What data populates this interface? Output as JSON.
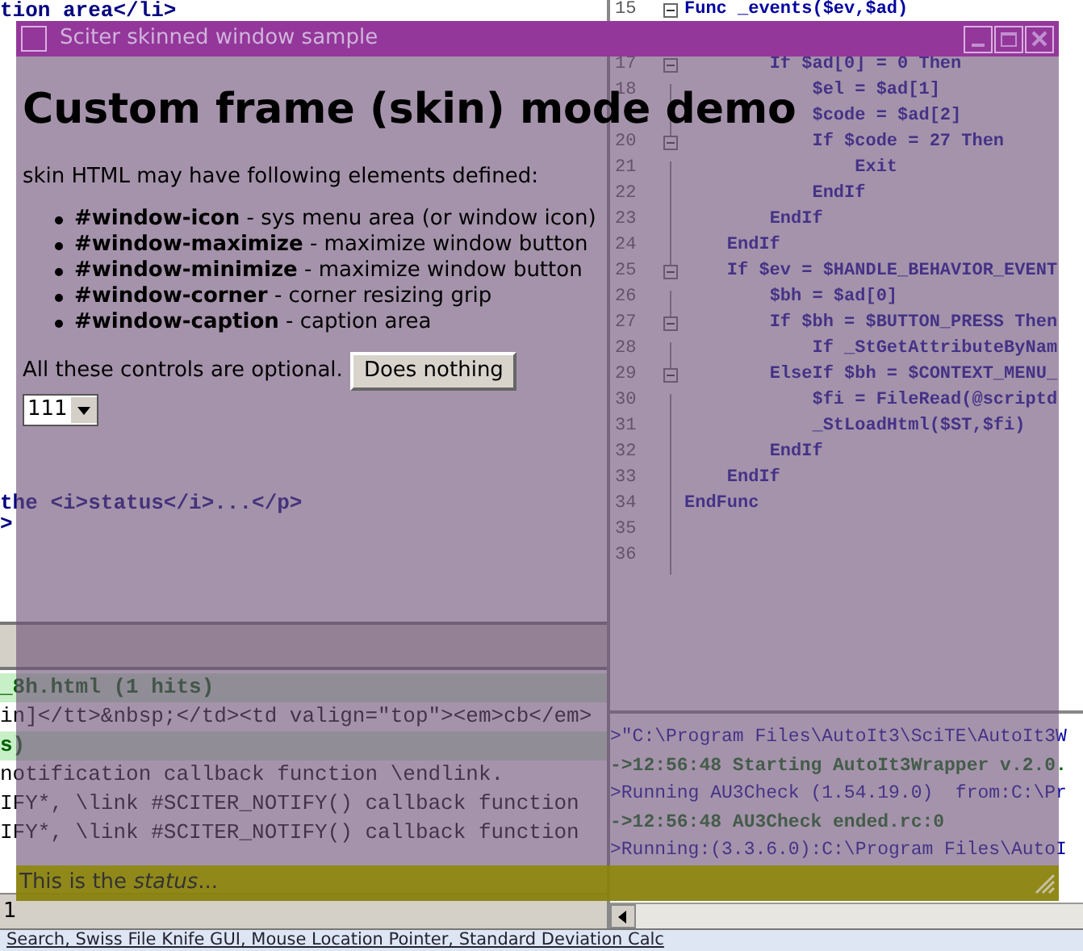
{
  "editor": {
    "left_top_lines": [
      "tion area</li>"
    ],
    "left_bottom_lines": [
      "the <i>status</i>...</p>",
      ">"
    ],
    "find_results": [
      {
        "kind": "header",
        "text": "_8h.html (1 hits)"
      },
      {
        "kind": "match",
        "text": "in]</tt>&nbsp;</td><td valign=\"top\"><em>cb</em>"
      },
      {
        "kind": "header",
        "text": "s)"
      },
      {
        "kind": "match",
        "text": "notification callback function \\endlink."
      },
      {
        "kind": "match",
        "text": "IFY*, \\link #SCITER_NOTIFY() callback function"
      },
      {
        "kind": "match",
        "text": "IFY*, \\link #SCITER_NOTIFY() callback function"
      }
    ],
    "status_bar": "1",
    "taskbar": "Search, Swiss File Knife GUI, Mouse Location Pointer, Standard Deviation Calc",
    "first_line": {
      "number": "15",
      "fold": true,
      "text": "Func _events($ev,$ad)"
    },
    "code_lines": [
      {
        "number": "17",
        "fold": true,
        "text": "        If $ad[0] = 0 Then"
      },
      {
        "number": "18",
        "fold": false,
        "text": "            $el = $ad[1]"
      },
      {
        "fold": false,
        "text": "            $code = $ad[2]"
      },
      {
        "number": "20",
        "fold": true,
        "text": "            If $code = 27 Then"
      },
      {
        "number": "21",
        "fold": false,
        "text": "                Exit"
      },
      {
        "number": "22",
        "fold": false,
        "text": "            EndIf"
      },
      {
        "number": "23",
        "fold": false,
        "text": "        EndIf"
      },
      {
        "number": "24",
        "fold": false,
        "text": "    EndIf"
      },
      {
        "number": "25",
        "fold": true,
        "text": "    If $ev = $HANDLE_BEHAVIOR_EVENT"
      },
      {
        "number": "26",
        "fold": false,
        "text": "        $bh = $ad[0]"
      },
      {
        "number": "27",
        "fold": true,
        "text": "        If $bh = $BUTTON_PRESS Then"
      },
      {
        "number": "28",
        "fold": false,
        "text": "            If _StGetAttributeByNam"
      },
      {
        "number": "29",
        "fold": true,
        "text": "        ElseIf $bh = $CONTEXT_MENU_"
      },
      {
        "number": "30",
        "fold": false,
        "text": "            $fi = FileRead(@scriptd"
      },
      {
        "number": "31",
        "fold": false,
        "text": "            _StLoadHtml($ST,$fi)"
      },
      {
        "number": "32",
        "fold": false,
        "text": "        EndIf"
      },
      {
        "number": "33",
        "fold": false,
        "text": "    EndIf"
      },
      {
        "number": "34",
        "fold": false,
        "text": "EndFunc"
      },
      {
        "number": "35",
        "fold": false
      },
      {
        "number": "36",
        "fold": false
      }
    ],
    "output": [
      {
        "kind": "info",
        "text": ">\"C:\\Program Files\\AutoIt3\\SciTE\\AutoIt3W"
      },
      {
        "kind": "ok",
        "text": "->12:56:48 Starting AutoIt3Wrapper v.2.0."
      },
      {
        "kind": "info",
        "text": ">Running AU3Check (1.54.19.0)  from:C:\\Pr"
      },
      {
        "kind": "ok",
        "text": "->12:56:48 AU3Check ended.rc:0"
      },
      {
        "kind": "info",
        "text": ">Running:(3.3.6.0):C:\\Program Files\\AutoI"
      }
    ]
  },
  "window": {
    "title": "Sciter skinned window sample",
    "heading": "Custom frame (skin) mode demo",
    "intro": "skin HTML may have following elements defined:",
    "elements": [
      {
        "name": "#window-icon",
        "description": "- sys menu area (or window icon)"
      },
      {
        "name": "#window-maximize",
        "description": "- maximize window button"
      },
      {
        "name": "#window-minimize",
        "description": "- maximize window button"
      },
      {
        "name": "#window-corner",
        "description": "- corner resizing grip"
      },
      {
        "name": "#window-caption",
        "description": "- caption area"
      }
    ],
    "note": "All these controls are optional.",
    "button": "Does nothing",
    "select": {
      "value": "111"
    },
    "status": "This is the *status*..."
  }
}
